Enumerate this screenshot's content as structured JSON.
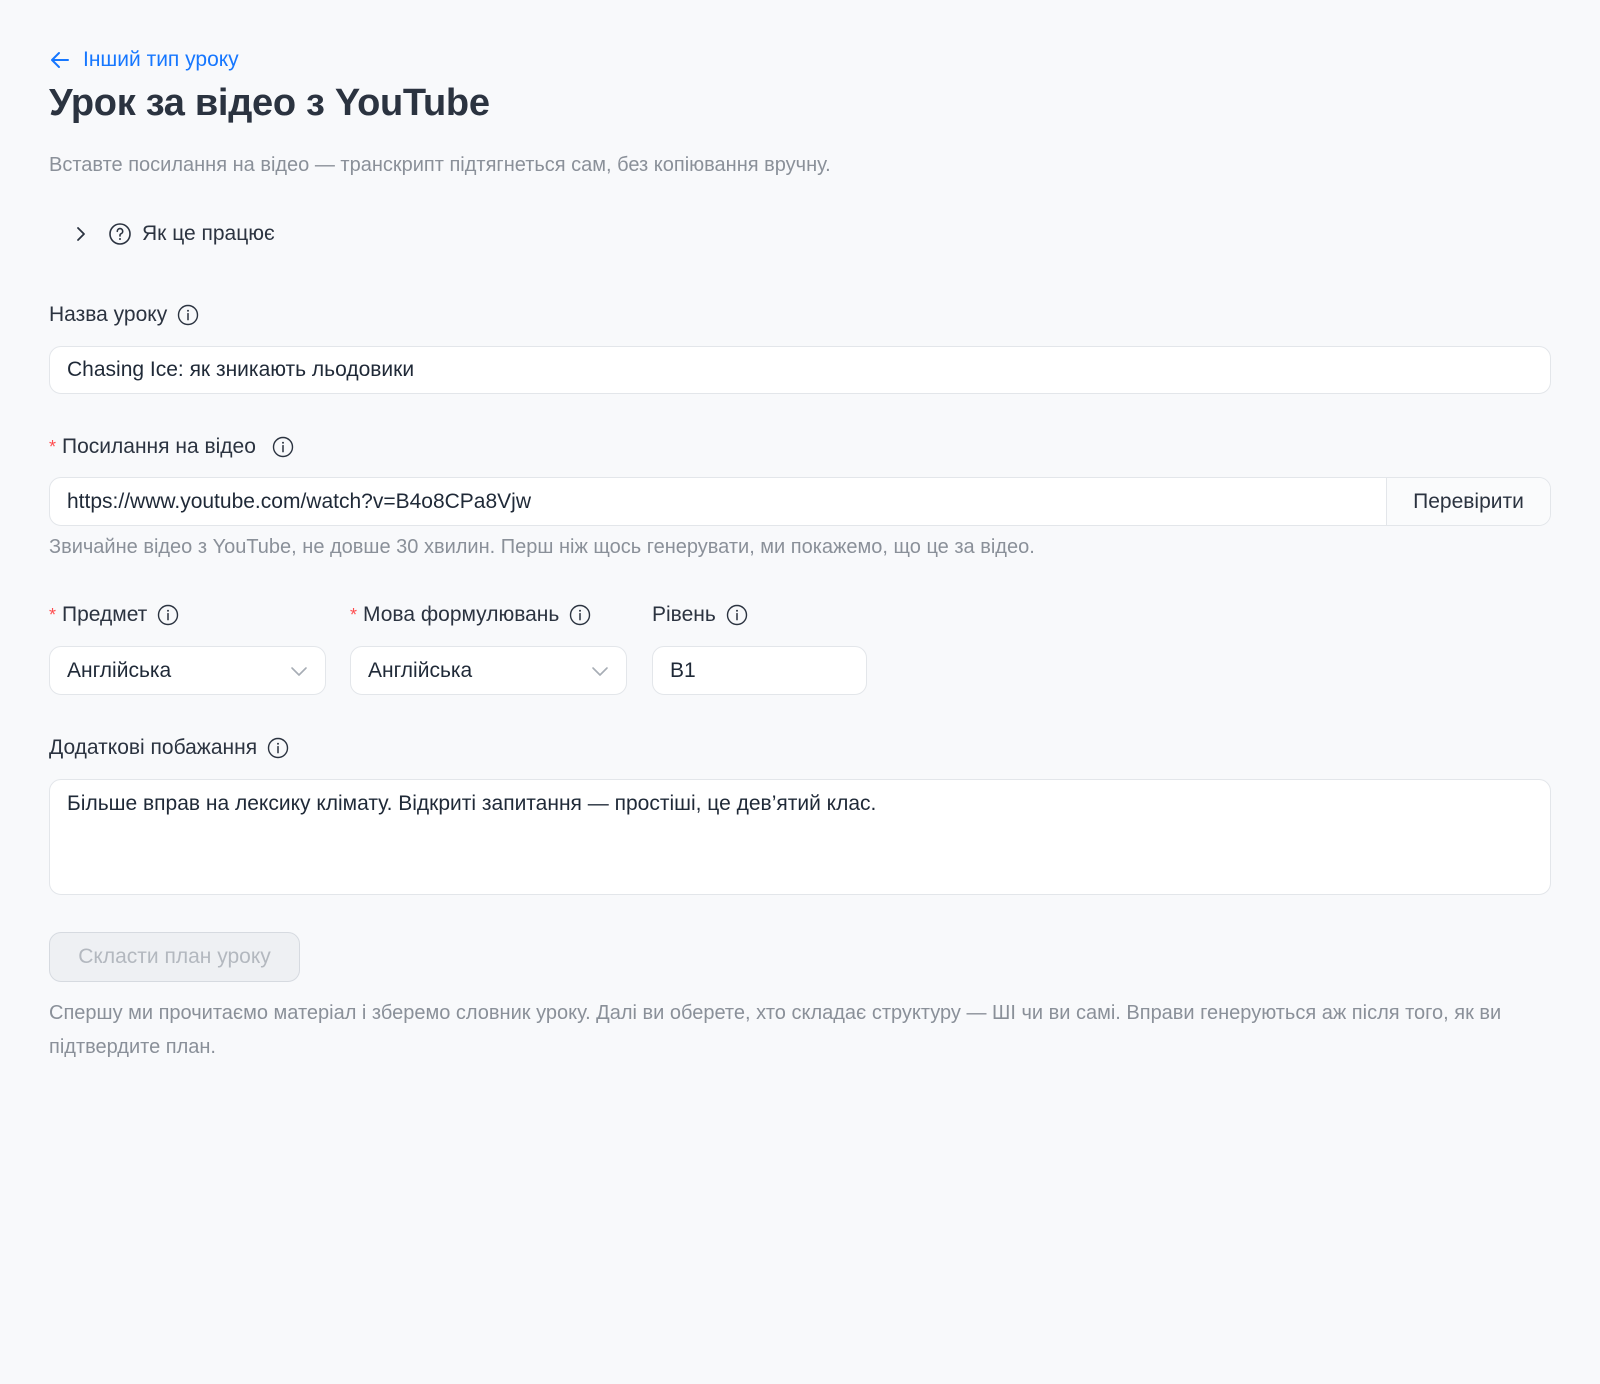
{
  "nav": {
    "back_label": "Інший тип уроку"
  },
  "header": {
    "title": "Урок за відео з YouTube",
    "subtitle": "Вставте посилання на відео — транскрипт підтягнеться сам, без копіювання вручну."
  },
  "how_it_works": {
    "label": "Як це працює"
  },
  "form": {
    "lesson_name": {
      "label": "Назва уроку",
      "value": "Chasing Ice: як зникають льодовики"
    },
    "video_link": {
      "required_mark": "*",
      "label": "Посилання на відео",
      "value": "https://www.youtube.com/watch?v=B4o8CPa8Vjw",
      "check_button": "Перевірити",
      "help": "Звичайне відео з YouTube, не довше 30 хвилин. Перш ніж щось генерувати, ми покажемо, що це за відео."
    },
    "subject": {
      "required_mark": "*",
      "label": "Предмет",
      "value": "Англійська"
    },
    "wording_language": {
      "required_mark": "*",
      "label": "Мова формулювань",
      "value": "Англійська"
    },
    "level": {
      "label": "Рівень",
      "value": "B1"
    },
    "extra_wishes": {
      "label": "Додаткові побажання",
      "value": "Більше вправ на лексику клімату. Відкриті запитання — простіші, це дев’ятий клас."
    },
    "submit": {
      "label": "Скласти план уроку",
      "disabled": true
    },
    "footer_help": "Спершу ми прочитаємо матеріал і зберемо словник уроку. Далі ви оберете, хто складає структуру — ШІ чи ви самі. Вправи генеруються аж після того, як ви підтвердите план."
  },
  "colors": {
    "accent": "#1677ff",
    "required": "#ff4d4f",
    "muted_text": "#8a9099",
    "background": "#f8f9fb"
  }
}
